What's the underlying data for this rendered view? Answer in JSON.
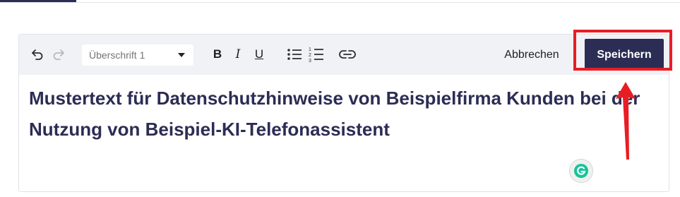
{
  "toolbar": {
    "heading_select": {
      "value": "Überschrift 1"
    },
    "bold_label": "B",
    "italic_label": "I",
    "underline_label": "U",
    "cancel_label": "Abbrechen",
    "save_label": "Speichern"
  },
  "content": {
    "heading": "Mustertext für Datenschutzhinweise von Beispielfirma Kunden bei der Nutzung von Beispiel-KI-Telefonassistent"
  },
  "colors": {
    "primary": "#2c2d54",
    "toolbar_bg": "#f1f2f5",
    "annotation": "#e81d24",
    "grammarly": "#15c39a"
  },
  "icons": [
    "undo-icon",
    "redo-icon",
    "chevron-down-icon",
    "bulleted-list-icon",
    "numbered-list-icon",
    "link-icon",
    "grammarly-icon",
    "arrow-up-icon"
  ]
}
